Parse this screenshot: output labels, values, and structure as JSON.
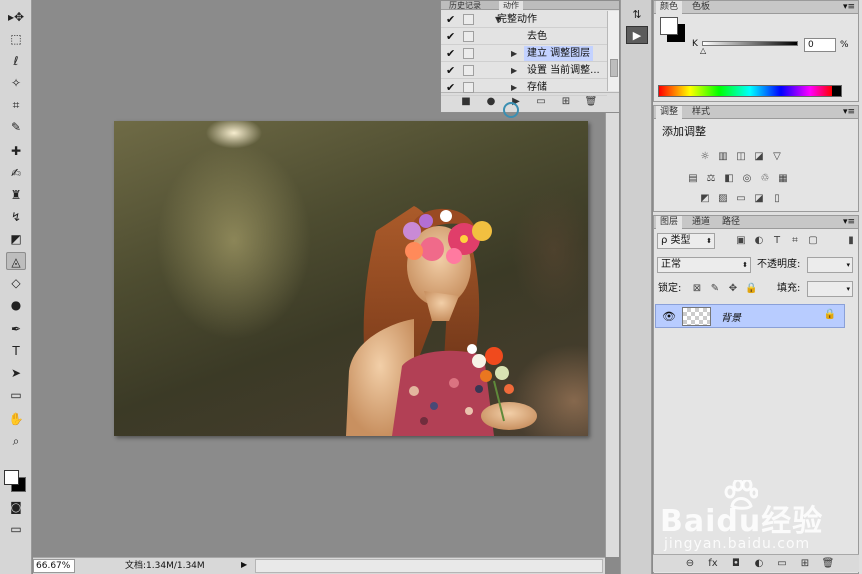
{
  "tools": [
    {
      "name": "move-tool",
      "glyph": "▸✥"
    },
    {
      "name": "marquee-tool",
      "glyph": "⬚"
    },
    {
      "name": "lasso-tool",
      "glyph": "ℓ"
    },
    {
      "name": "quick-selection-tool",
      "glyph": "✧"
    },
    {
      "name": "crop-tool",
      "glyph": "⌗"
    },
    {
      "name": "eyedropper-tool",
      "glyph": "✎"
    },
    {
      "name": "healing-brush-tool",
      "glyph": "✚"
    },
    {
      "name": "brush-tool",
      "glyph": "✍"
    },
    {
      "name": "clone-stamp-tool",
      "glyph": "♜"
    },
    {
      "name": "history-brush-tool",
      "glyph": "↯"
    },
    {
      "name": "eraser-tool",
      "glyph": "◩"
    },
    {
      "name": "paint-bucket-tool",
      "glyph": "◬"
    },
    {
      "name": "blur-tool",
      "glyph": "◇"
    },
    {
      "name": "dodge-tool",
      "glyph": "●"
    },
    {
      "name": "pen-tool",
      "glyph": "✒"
    },
    {
      "name": "type-tool",
      "glyph": "T"
    },
    {
      "name": "path-selection-tool",
      "glyph": "➤"
    },
    {
      "name": "rectangle-tool",
      "glyph": "▭"
    },
    {
      "name": "hand-tool",
      "glyph": "✋"
    },
    {
      "name": "zoom-tool",
      "glyph": "⌕"
    }
  ],
  "actions_panel": {
    "tabs": [
      "历史记录",
      "动作"
    ],
    "rows": [
      {
        "checked": "✔",
        "triangle": "▼",
        "label": "完整动作",
        "selected": false
      },
      {
        "checked": "✔",
        "triangle": "",
        "label": "去色",
        "selected": false
      },
      {
        "checked": "✔",
        "triangle": "▶",
        "label": "建立 调整图层",
        "selected": true
      },
      {
        "checked": "✔",
        "triangle": "▶",
        "label": "设置 当前调整...",
        "selected": false
      },
      {
        "checked": "✔",
        "triangle": "▶",
        "label": "存储",
        "selected": false
      }
    ],
    "buttons": [
      "■",
      "●",
      "▶",
      "▭",
      "⊞",
      "🗑"
    ]
  },
  "strip_icons": [
    "⇅",
    "▶"
  ],
  "color_panel": {
    "tabs": [
      "颜色",
      "色板"
    ],
    "k_label": "K",
    "k_value": "0",
    "percent": "%"
  },
  "adjustments_panel": {
    "tabs": [
      "调整",
      "样式"
    ],
    "title": "添加调整",
    "row1": [
      "☼",
      "▥",
      "◫",
      "◪",
      "▽"
    ],
    "row2": [
      "▤",
      "⚖",
      "◧",
      "◎",
      "♲",
      "▦"
    ],
    "row3": [
      "◩",
      "▨",
      "▭",
      "◪",
      "▯"
    ]
  },
  "layers_panel": {
    "tabs": [
      "图层",
      "通道",
      "路径"
    ],
    "filter_label": "ρ 类型",
    "filter_icons": [
      "▣",
      "◐",
      "T",
      "⌗",
      "▢"
    ],
    "blend_mode": "正常",
    "opacity_label": "不透明度:",
    "lock_label": "锁定:",
    "lock_icons": [
      "⊠",
      "✎",
      "✥",
      "🔒"
    ],
    "fill_label": "填充:",
    "layer": {
      "name": "背景"
    },
    "bottom_icons": [
      "⊖",
      "fx",
      "◘",
      "◐",
      "▭",
      "⊞",
      "🗑"
    ]
  },
  "status": {
    "zoom": "66.67%",
    "docinfo": "文档:1.34M/1.34M",
    "arrow": "▶"
  },
  "watermark": {
    "logo": "Baidu经验",
    "sub": "jingyan.baidu.com"
  }
}
